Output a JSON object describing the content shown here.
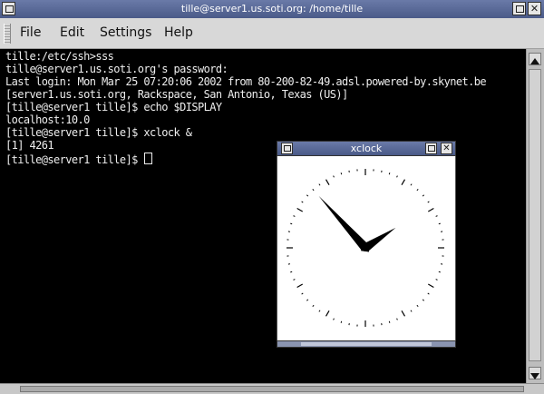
{
  "terminal_window": {
    "title": "tille@server1.us.soti.org: /home/tille",
    "menu": [
      "File",
      "Edit",
      "Settings",
      "Help"
    ],
    "lines": [
      "tille:/etc/ssh>sss",
      "tille@server1.us.soti.org's password:",
      "Last login: Mon Mar 25 07:20:06 2002 from 80-200-82-49.adsl.powered-by.skynet.be",
      "[server1.us.soti.org, Rackspace, San Antonio, Texas (US)]",
      "[tille@server1 tille]$ echo $DISPLAY",
      "localhost:10.0",
      "[tille@server1 tille]$ xclock &",
      "[1] 4261",
      "[tille@server1 tille]$ "
    ]
  },
  "xclock_window": {
    "title": "xclock",
    "time": {
      "hours": 1,
      "minutes": 53
    }
  },
  "colors": {
    "titlebar": "#5a6a98",
    "terminal_bg": "#000000",
    "terminal_fg": "#eeeeee",
    "chrome": "#d8d8d8"
  }
}
